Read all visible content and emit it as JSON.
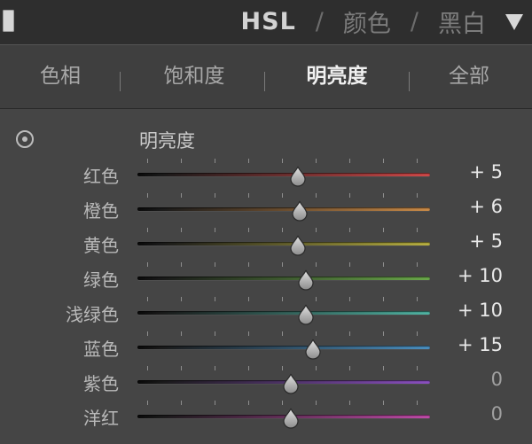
{
  "header": {
    "modes": [
      "HSL",
      "颜色",
      "黑白"
    ],
    "active_mode": "HSL",
    "separator": "/",
    "collapse_icon": "triangle-down-icon"
  },
  "tabs": [
    {
      "label": "色相",
      "active": false
    },
    {
      "label": "饱和度",
      "active": false
    },
    {
      "label": "明亮度",
      "active": true
    },
    {
      "label": "全部",
      "active": false
    }
  ],
  "section": {
    "title": "明亮度",
    "target_icon": "target-adjust-icon"
  },
  "slider_range": [
    -100,
    100
  ],
  "sliders": [
    {
      "label": "红色",
      "value": 5,
      "display": "+ 5",
      "color": "#d04848"
    },
    {
      "label": "橙色",
      "value": 6,
      "display": "+ 6",
      "color": "#c98a48"
    },
    {
      "label": "黄色",
      "value": 5,
      "display": "+ 5",
      "color": "#b8b040"
    },
    {
      "label": "绿色",
      "value": 10,
      "display": "+ 10",
      "color": "#6aa84a"
    },
    {
      "label": "浅绿色",
      "value": 10,
      "display": "+ 10",
      "color": "#4fb3a2"
    },
    {
      "label": "蓝色",
      "value": 15,
      "display": "+ 15",
      "color": "#4a8fc0"
    },
    {
      "label": "紫色",
      "value": 0,
      "display": "0",
      "color": "#8a4fc0"
    },
    {
      "label": "洋红",
      "value": 0,
      "display": "0",
      "color": "#c04aa8"
    }
  ]
}
